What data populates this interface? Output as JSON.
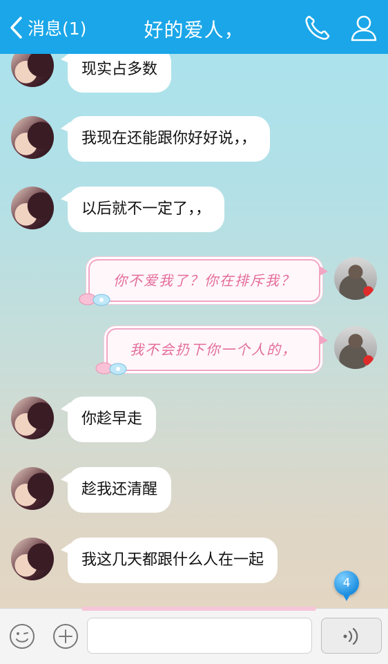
{
  "header": {
    "back_label": "消息(1)",
    "title": "好的爱人，",
    "back_icon": "chevron-left-icon",
    "call_icon": "phone-icon",
    "profile_icon": "user-icon"
  },
  "messages": [
    {
      "from": "her",
      "text": "现实占多数"
    },
    {
      "from": "her",
      "text": "我现在还能跟你好好说，，"
    },
    {
      "from": "her",
      "text": "以后就不一定了，，"
    },
    {
      "from": "me",
      "text": "你不爱我了？你在排斥我？"
    },
    {
      "from": "me",
      "text": "我不会扔下你一个人的，"
    },
    {
      "from": "her",
      "text": "你趁早走"
    },
    {
      "from": "her",
      "text": "趁我还清醒"
    },
    {
      "from": "her",
      "text": "我这几天都跟什么人在一起"
    }
  ],
  "unread_badge": "4",
  "input": {
    "value": "",
    "placeholder": ""
  },
  "colors": {
    "header": "#1aa6e8",
    "pink_text": "#e46c9a",
    "pink_border": "#f2a5c3"
  }
}
